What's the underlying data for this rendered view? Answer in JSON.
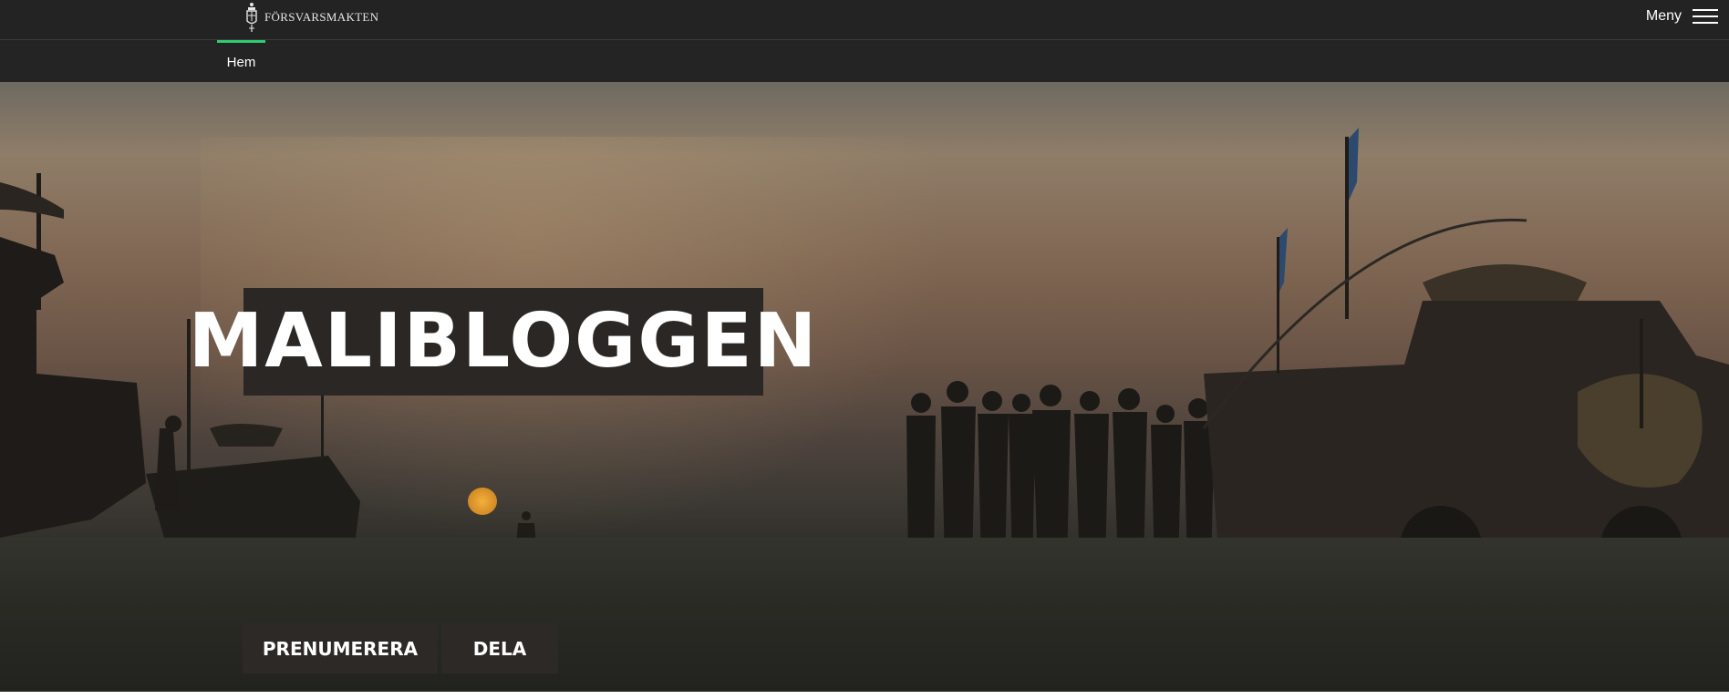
{
  "header": {
    "logo_text": "FÖRSVARSMAKTEN",
    "menu_label": "Meny"
  },
  "subnav": {
    "items": [
      {
        "label": "Hem",
        "active": true
      }
    ],
    "accent_color": "#2ecc71"
  },
  "hero": {
    "title": "MALIBLOGGEN"
  },
  "actions": {
    "subscribe_label": "PRENUMERERA",
    "share_label": "DELA"
  },
  "icons": [
    "crest-logo-icon",
    "hamburger-menu-icon"
  ]
}
